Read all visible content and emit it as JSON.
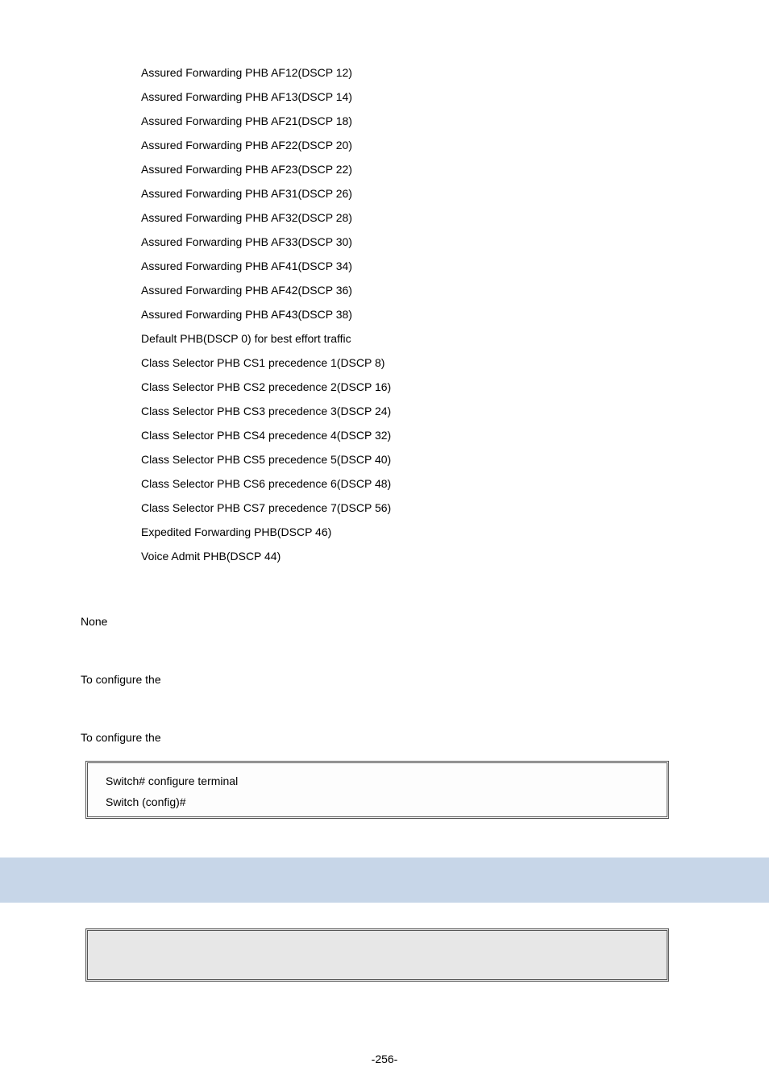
{
  "items": [
    "Assured Forwarding PHB AF12(DSCP 12)",
    "Assured Forwarding PHB AF13(DSCP 14)",
    "Assured Forwarding PHB AF21(DSCP 18)",
    "Assured Forwarding PHB AF22(DSCP 20)",
    "Assured Forwarding PHB AF23(DSCP 22)",
    "Assured Forwarding PHB AF31(DSCP 26)",
    "Assured Forwarding PHB AF32(DSCP 28)",
    "Assured Forwarding PHB AF33(DSCP 30)",
    "Assured Forwarding PHB AF41(DSCP 34)",
    "Assured Forwarding PHB AF42(DSCP 36)",
    "Assured Forwarding PHB AF43(DSCP 38)",
    "Default PHB(DSCP 0) for best effort traffic",
    "Class Selector PHB CS1 precedence 1(DSCP 8)",
    "Class Selector PHB CS2 precedence 2(DSCP 16)",
    "Class Selector PHB CS3 precedence 3(DSCP 24)",
    "Class Selector PHB CS4 precedence 4(DSCP 32)",
    "Class Selector PHB CS5 precedence 5(DSCP 40)",
    "Class Selector PHB CS6 precedence 6(DSCP 48)",
    "Class Selector PHB CS7 precedence 7(DSCP 56)",
    " Expedited Forwarding PHB(DSCP 46)",
    "  Voice Admit PHB(DSCP 44)"
  ],
  "none": "None",
  "conf1": "To configure the",
  "conf2": "To configure the",
  "terminal": {
    "line1": "Switch# configure terminal",
    "line2": "Switch (config)#"
  },
  "page_number": "-256-"
}
